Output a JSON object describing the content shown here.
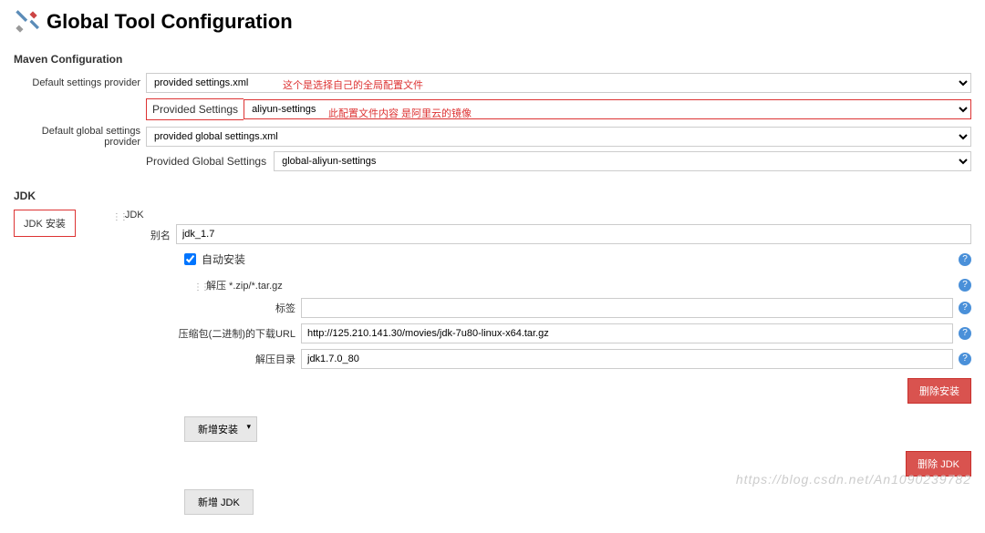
{
  "header": {
    "title": "Global Tool Configuration"
  },
  "maven": {
    "section_title": "Maven Configuration",
    "default_settings_label": "Default settings provider",
    "default_settings_value": "provided settings.xml",
    "provided_settings_label": "Provided Settings",
    "provided_settings_value": "aliyun-settings",
    "default_global_label": "Default global settings provider",
    "default_global_value": "provided global settings.xml",
    "provided_global_label": "Provided Global Settings",
    "provided_global_value": "global-aliyun-settings",
    "annotation1": "这个是选择自己的全局配置文件",
    "annotation2": "此配置文件内容 是阿里云的镜像"
  },
  "jdk": {
    "section_title": "JDK",
    "install_label": "JDK 安装",
    "jdk_title": "JDK",
    "alias_label": "别名",
    "alias_value": "jdk_1.7",
    "auto_install_label": "自动安装",
    "extract_label": "解压 *.zip/*.tar.gz",
    "tag_label": "标签",
    "tag_value": "",
    "url_label": "压缩包(二进制)的下载URL",
    "url_value": "http://125.210.141.30/movies/jdk-7u80-linux-x64.tar.gz",
    "extract_dir_label": "解压目录",
    "extract_dir_value": "jdk1.7.0_80",
    "delete_install_btn": "删除安装",
    "add_install_btn": "新增安装",
    "delete_jdk_btn": "删除 JDK",
    "add_jdk_btn": "新增 JDK"
  },
  "help": "?",
  "watermark": "https://blog.csdn.net/An1090239782"
}
